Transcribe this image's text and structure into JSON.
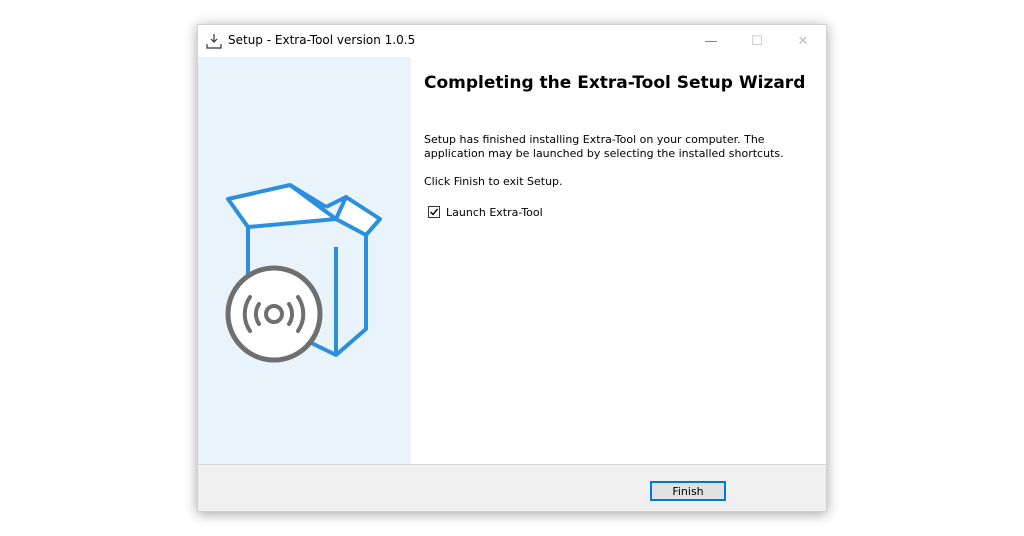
{
  "window": {
    "title": "Setup - Extra-Tool version 1.0.5"
  },
  "colors": {
    "accent": "#0078d7",
    "box_blue": "#2a8fdc",
    "disc_gray": "#6f6f6f",
    "left_panel_bg": "#e9f3fb"
  },
  "icons": {
    "app": "installer-tray-icon",
    "illustration": "box-with-disc-illustration"
  },
  "content": {
    "heading": "Completing the Extra-Tool Setup Wizard",
    "body": "Setup has finished installing Extra-Tool on your computer. The application may be launched by selecting the installed shortcuts.",
    "exit_instruction": "Click Finish to exit Setup.",
    "launch_checkbox": {
      "label": "Launch Extra-Tool",
      "checked": true
    }
  },
  "footer": {
    "finish_label": "Finish"
  }
}
